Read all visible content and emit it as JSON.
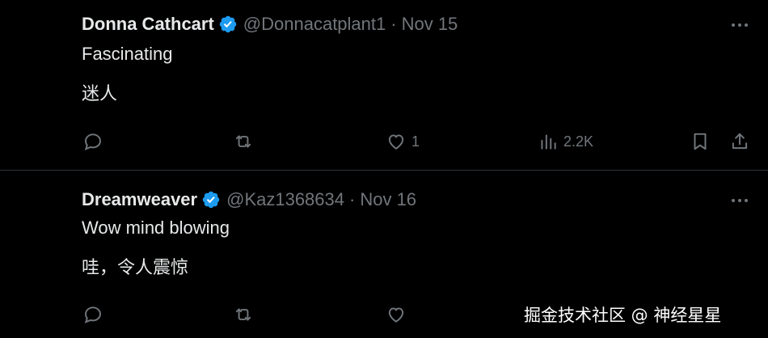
{
  "tweets": [
    {
      "name": "Donna Cathcart",
      "handle": "@Donnacatplant1",
      "separator": "·",
      "date": "Nov 15",
      "lines": [
        "Fascinating",
        "迷人"
      ],
      "stats": {
        "likes": "1",
        "views": "2.2K"
      },
      "avatar_icon": "cat-photo-avatar"
    },
    {
      "name": "Dreamweaver",
      "handle": "@Kaz1368634",
      "separator": "·",
      "date": "Nov 16",
      "lines": [
        "Wow mind blowing",
        "哇，令人震惊"
      ],
      "avatar_icon": "person-photo-avatar"
    }
  ],
  "watermark": "掘金技术社区 @ 神经星星",
  "colors": {
    "background": "#000000",
    "text": "#e7e9ea",
    "muted": "#71767b",
    "verified": "#1d9bf0",
    "divider": "#2f3336"
  }
}
